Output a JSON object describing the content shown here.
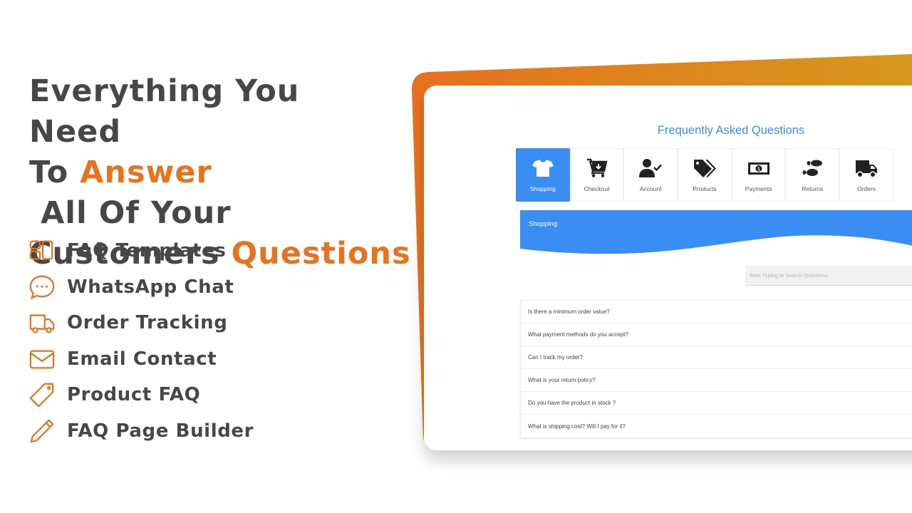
{
  "headline": {
    "line1": "Everything You Need",
    "line2_pre": "To ",
    "line2_accent": "Answer",
    "line2_post": " All Of Your",
    "line3_pre": "Customers ",
    "line3_accent": "Questions"
  },
  "features": [
    {
      "icon": "templates-icon",
      "label": "FAQ Templates"
    },
    {
      "icon": "chat-bubble-icon",
      "label": "WhatsApp Chat"
    },
    {
      "icon": "truck-icon",
      "label": "Order Tracking"
    },
    {
      "icon": "envelope-icon",
      "label": "Email Contact"
    },
    {
      "icon": "tag-icon",
      "label": "Product FAQ"
    },
    {
      "icon": "pencil-icon",
      "label": "FAQ Page Builder"
    }
  ],
  "colors": {
    "accent_orange": "#e8731f",
    "accent_gold": "#d6961d",
    "primary_blue": "#3a8ef3",
    "text_dark": "#474747"
  },
  "faq": {
    "title": "Frequently Asked Questions",
    "tabs": [
      {
        "icon": "tshirt-icon",
        "label": "Shopping",
        "active": true
      },
      {
        "icon": "cart-icon",
        "label": "Checkout",
        "active": false
      },
      {
        "icon": "user-check-icon",
        "label": "Account",
        "active": false
      },
      {
        "icon": "tags-icon",
        "label": "Products",
        "active": false
      },
      {
        "icon": "money-bill-icon",
        "label": "Payments",
        "active": false
      },
      {
        "icon": "footprints-icon",
        "label": "Returns",
        "active": false
      },
      {
        "icon": "delivery-truck-icon",
        "label": "Orders",
        "active": false
      }
    ],
    "banner_label": "Shopping",
    "search_placeholder": "Start Typing to Search Questions",
    "questions": [
      "Is there a minimum order value?",
      "What payment methods do you accept?",
      "Can I track my order?",
      "What is your return policy?",
      "Do you have the product in stock ?",
      "What is shipping cost? Will I pay for it?"
    ]
  }
}
